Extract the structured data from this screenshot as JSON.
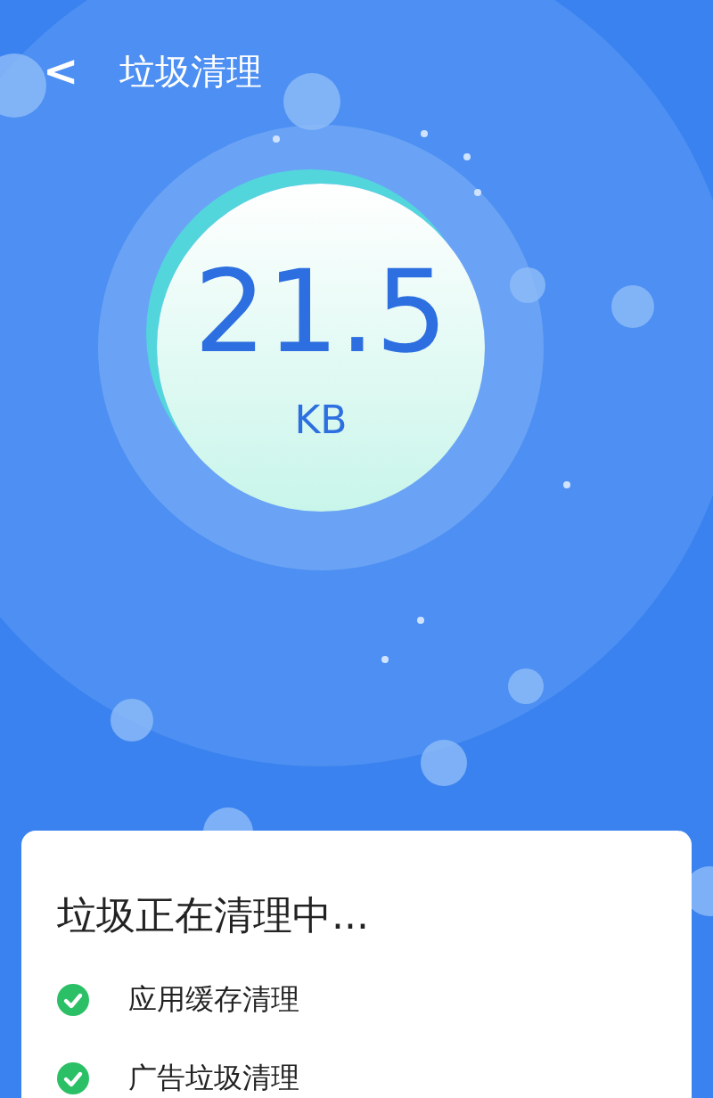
{
  "header": {
    "back": "<",
    "title": "垃圾清理"
  },
  "meter": {
    "value": "21.5",
    "unit": "KB"
  },
  "card": {
    "title": "垃圾正在清理中...",
    "items": [
      {
        "label": "应用缓存清理",
        "checked": true
      },
      {
        "label": "广告垃圾清理",
        "checked": true
      }
    ]
  }
}
